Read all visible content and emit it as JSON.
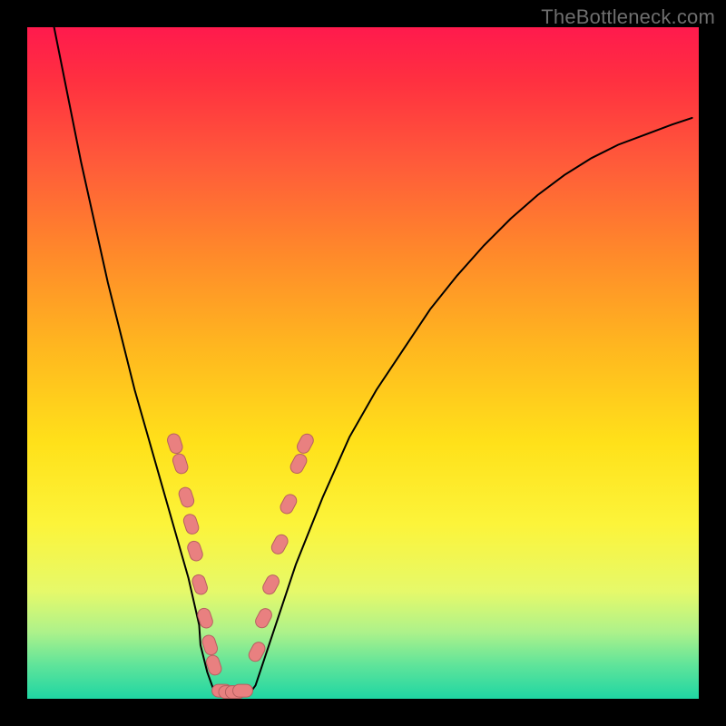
{
  "watermark": {
    "text": "TheBottleneck.com"
  },
  "colors": {
    "bg": "#000000",
    "curve": "#000000",
    "marker_fill": "#e98080",
    "marker_stroke": "#b66060",
    "gradient_stops": [
      "#ff1a4d",
      "#ff3040",
      "#ff5a3a",
      "#ff8a2a",
      "#ffb81f",
      "#ffe11a",
      "#fcf43a",
      "#e6f96a",
      "#aef28a",
      "#5fe49a",
      "#1fd6a3"
    ]
  },
  "chart_data": {
    "type": "line",
    "title": "",
    "xlabel": "",
    "ylabel": "",
    "xlim": [
      0,
      100
    ],
    "ylim": [
      0,
      100
    ],
    "grid": false,
    "legend": false,
    "series": [
      {
        "name": "left_branch",
        "x": [
          4,
          6,
          8,
          10,
          12,
          14,
          16,
          18,
          20,
          22,
          24,
          25.6,
          25.8,
          26.8,
          27.8,
          28.2
        ],
        "y": [
          100,
          90,
          80,
          71,
          62,
          54,
          46,
          39,
          32,
          25,
          18,
          11,
          8,
          4,
          1.2,
          0.9
        ]
      },
      {
        "name": "bottom_flat",
        "x": [
          28.2,
          29.2,
          30.2,
          31.2,
          32.2,
          33.2
        ],
        "y": [
          0.85,
          0.8,
          0.8,
          0.8,
          0.8,
          0.85
        ]
      },
      {
        "name": "right_branch",
        "x": [
          33.2,
          34,
          36,
          38,
          40,
          44,
          48,
          52,
          56,
          60,
          64,
          68,
          72,
          76,
          80,
          84,
          88,
          92,
          96,
          99
        ],
        "y": [
          0.9,
          2,
          8,
          14,
          20,
          30,
          39,
          46,
          52,
          58,
          63,
          67.5,
          71.5,
          75,
          78,
          80.5,
          82.5,
          84,
          85.5,
          86.5
        ]
      }
    ],
    "markers": {
      "name": "highlighted_points",
      "shape": "pill",
      "points": [
        {
          "x": 22.0,
          "y": 38.0,
          "branch": "left"
        },
        {
          "x": 22.8,
          "y": 35.0,
          "branch": "left"
        },
        {
          "x": 23.7,
          "y": 30.0,
          "branch": "left"
        },
        {
          "x": 24.4,
          "y": 26.0,
          "branch": "left"
        },
        {
          "x": 25.0,
          "y": 22.0,
          "branch": "left"
        },
        {
          "x": 25.7,
          "y": 17.0,
          "branch": "left"
        },
        {
          "x": 26.5,
          "y": 12.0,
          "branch": "left"
        },
        {
          "x": 27.2,
          "y": 8.0,
          "branch": "left"
        },
        {
          "x": 27.8,
          "y": 5.0,
          "branch": "left"
        },
        {
          "x": 29.0,
          "y": 1.2,
          "branch": "bottom"
        },
        {
          "x": 30.0,
          "y": 1.0,
          "branch": "bottom"
        },
        {
          "x": 31.0,
          "y": 1.0,
          "branch": "bottom"
        },
        {
          "x": 32.1,
          "y": 1.2,
          "branch": "bottom"
        },
        {
          "x": 34.2,
          "y": 7.0,
          "branch": "right"
        },
        {
          "x": 35.2,
          "y": 12.0,
          "branch": "right"
        },
        {
          "x": 36.3,
          "y": 17.0,
          "branch": "right"
        },
        {
          "x": 37.6,
          "y": 23.0,
          "branch": "right"
        },
        {
          "x": 38.9,
          "y": 29.0,
          "branch": "right"
        },
        {
          "x": 40.4,
          "y": 35.0,
          "branch": "right"
        },
        {
          "x": 41.4,
          "y": 38.0,
          "branch": "right"
        }
      ]
    }
  }
}
